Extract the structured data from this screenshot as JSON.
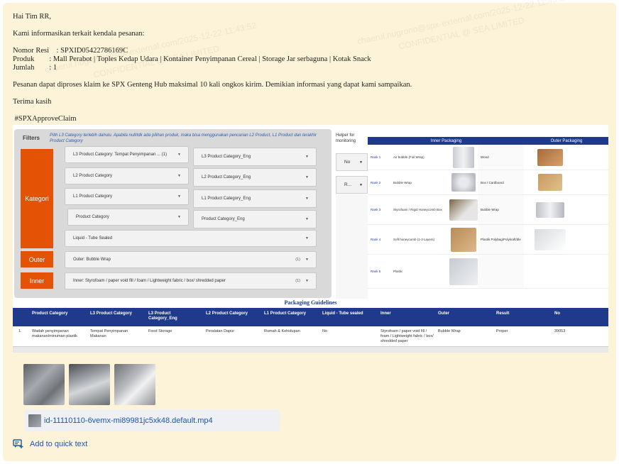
{
  "message": {
    "greeting": "Hai Tim RR,",
    "intro": "Kami informasikan terkait kendala pesanan:",
    "resi_label": "Nomor Resi    : SPXID05422786169C",
    "produk_label": "Produk        : Mall Perabot | Toples Kedap Udara | Kontainer Penyimpanan Cereal | Storage Jar serbaguna | Kotak Snack",
    "jumlah_label": "Jumlah        : 1",
    "body": "Pesanan dapat diproses klaim ke SPX Genteng Hub maksimal 10 kali ongkos kirim. Demikian informasi yang dapat kami sampaikan.",
    "closing": "Terima kasih",
    "hashtag": " #SPXApproveClaim"
  },
  "watermark": {
    "email": "chaerul.nugrono@spx-external.com/2025-12-22 11:43:52",
    "confidential": "CONFIDENTIAL @ SEA LIMITED"
  },
  "screenshot": {
    "filters_title": "Filters",
    "filters_note": "Pilih L3 Category terlebih dahulu. Apabila null/tdk ada pilihan produk, maka bisa menggunakan pencarian L2 Product, L1 Product dan terakhir Product Category",
    "side_labels": {
      "kategori": "Kategori",
      "outer": "Outer",
      "inner": "Inner"
    },
    "dropdowns": {
      "l3": "L3 Product Category: Tempat Penyimpanan ... (1)",
      "l3_eng": "L3 Product Category_Eng",
      "l2": "L2 Product Category",
      "l2_eng": "L2 Product Category_Eng",
      "l1": "L1 Product Category",
      "l1_eng": "L1 Product Category_Eng",
      "pc": "Product Category",
      "pc_eng": "Product Category_Eng",
      "liquid": "Liquid - Tube Sealed",
      "outer": "Outer: Bubble Wrap",
      "outer_count": "(1)",
      "inner": "Inner: Styrofoam / paper void fill / foam / Lightweight fabric / box/ shredded paper",
      "inner_count": "(1)"
    },
    "helper": {
      "title_1": "Helper for",
      "title_2": "monitoring",
      "btn1": "No",
      "btn2": "R..."
    },
    "packaging": {
      "inner_header": "Inner Packaging",
      "outer_header": "Outer Packaging",
      "rows": [
        {
          "rank": "Rank 1",
          "inner": "Air bubble (Foil Wrap)",
          "outer": "Wood"
        },
        {
          "rank": "Rank 2",
          "inner": "Bubble Wrap",
          "outer": "Box / Cardboard"
        },
        {
          "rank": "Rank 3",
          "inner": "Styrofoam / Rigid Honeycomb Box",
          "outer": "Bubble Wrap"
        },
        {
          "rank": "Rank 4",
          "inner": "Soft honeycomb (1-3 Layers)",
          "outer": "Plastik Polybag/Polykraft/dle"
        },
        {
          "rank": "Rank 5",
          "inner": "Plastic",
          "outer": ""
        }
      ]
    },
    "guidelines_title": "Packaging Guidelines",
    "table": {
      "headers": [
        "Product Category",
        "L3 Product Category",
        "L3 Product Category_Eng",
        "L2 Product Category",
        "L1 Product Category",
        "Liquid - Tube sealed",
        "Inner",
        "Outer",
        "Result",
        "No"
      ],
      "row": [
        "1.",
        "Wadah penyimpanan makanan/minuman plastik",
        "Tempat Penyimpanan Makanan",
        "Food Storage",
        "Peralatan Dapur",
        "Rumah & Kehidupan",
        "No",
        "Styrofoam / paper void fill / foam / Lightweight fabric / box/ shredded paper",
        "Bubble Wrap",
        "Proper",
        "39053"
      ]
    }
  },
  "attachments": {
    "video_name": "id-11110110-6vemx-mi89981jc5xk48.default.mp4"
  },
  "actions": {
    "quick_text": "Add to quick text"
  }
}
